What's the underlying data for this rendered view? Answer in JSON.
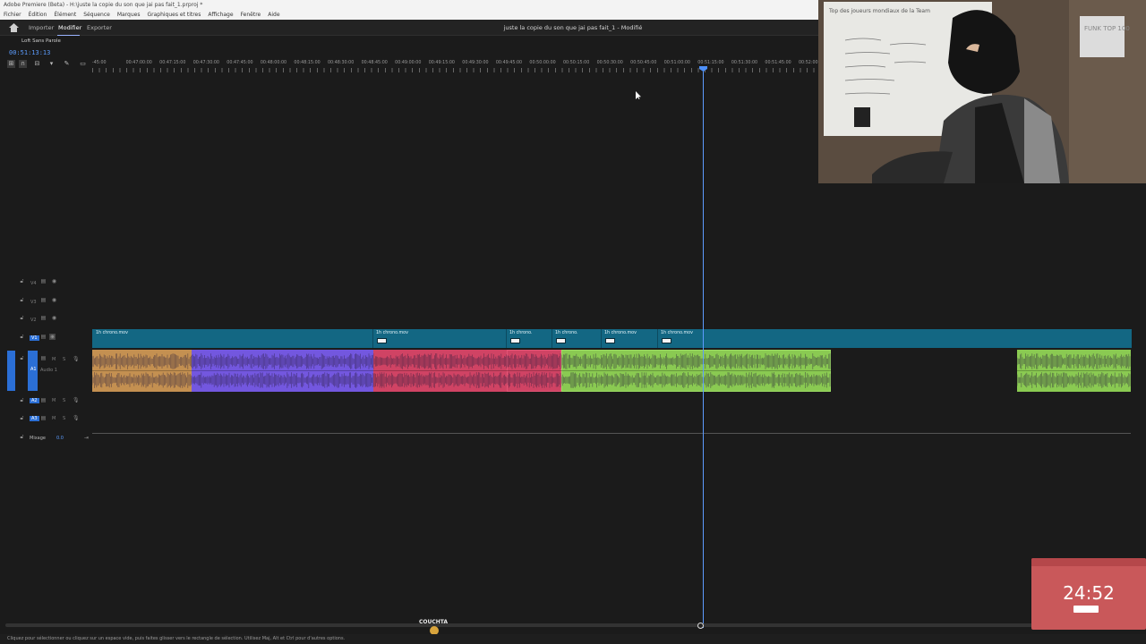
{
  "titlebar": {
    "text": "Adobe Premiere (Beta) - H:\\juste la copie du son que jai pas fait_1.prproj *"
  },
  "menu": [
    "Fichier",
    "Édition",
    "Élément",
    "Séquence",
    "Marques",
    "Graphiques et titres",
    "Affichage",
    "Fenêtre",
    "Aide"
  ],
  "workspace": {
    "import": "Importer",
    "edit": "Modifier",
    "export": "Exporter",
    "project_title": "juste la copie du son que jai pas fait_1 - Modifié"
  },
  "timeline": {
    "sequence_name": "Loft Sans Parole",
    "timecode": "00:51:13:13",
    "ruler_labels": [
      "-45:00",
      "00:47:00:00",
      "00:47:15:00",
      "00:47:30:00",
      "00:47:45:00",
      "00:48:00:00",
      "00:48:15:00",
      "00:48:30:00",
      "00:48:45:00",
      "00:49:00:00",
      "00:49:15:00",
      "00:49:30:00",
      "00:49:45:00",
      "00:50:00:00",
      "00:50:15:00",
      "00:50:30:00",
      "00:50:45:00",
      "00:51:00:00",
      "00:51:15:00",
      "00:51:30:00",
      "00:51:45:00",
      "00:52:00:00"
    ],
    "tracks_video": [
      "V4",
      "V3",
      "V2",
      "V1"
    ],
    "tracks_audio": [
      "A1",
      "A2",
      "A3"
    ],
    "audio1_name": "Audio 1",
    "mix_label": "Mixage",
    "mix_value": "0.0",
    "video_clips": [
      "1h chrono.mov",
      "1h chrono.mov",
      "1h chrono.",
      "1h chrono.",
      "1h chrono.mov",
      "1h chrono.mov"
    ],
    "audio_clip_colors": [
      "#d39a56",
      "#7b5cf0",
      "#e0466a",
      "#e0466a",
      "#94d957",
      "#94d957"
    ]
  },
  "status_bar": "Cliquez pour sélectionner ou cliquez sur un espace vide, puis faites glisser vers le rectangle de sélection. Utilisez Maj, Alt et Ctrl pour d'autres options.",
  "overlay": {
    "badge": "COUCHTA",
    "timer": "24:52",
    "whiteboard_text": "Top des joueurs mondiaux de la Team",
    "poster_text": "FUNK TOP 100"
  }
}
